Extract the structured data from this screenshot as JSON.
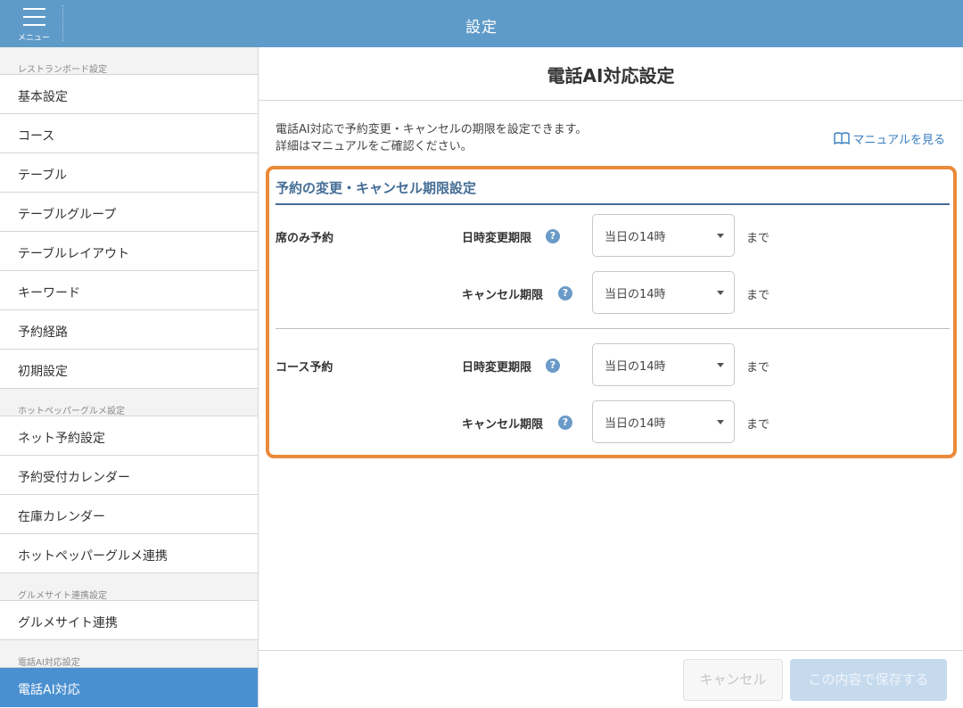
{
  "header": {
    "menu_label": "メニュー",
    "title": "設定"
  },
  "sidebar": {
    "section1": "レストランボード設定",
    "items1": [
      "基本設定",
      "コース",
      "テーブル",
      "テーブルグループ",
      "テーブルレイアウト",
      "キーワード",
      "予約経路",
      "初期設定"
    ],
    "section2": "ホットペッパーグルメ設定",
    "items2": [
      "ネット予約設定",
      "予約受付カレンダー",
      "在庫カレンダー",
      "ホットペッパーグルメ連携"
    ],
    "section3": "グルメサイト連携設定",
    "items3": [
      "グルメサイト連携"
    ],
    "section4": "電話AI対応設定",
    "items4": [
      "電話AI対応"
    ]
  },
  "main": {
    "title": "電話AI対応設定",
    "desc_line1": "電話AI対応で予約変更・キャンセルの期限を設定できます。",
    "desc_line2": "詳細はマニュアルをご確認ください。",
    "manual_link": "マニュアルを見る",
    "panel_title": "予約の変更・キャンセル期限設定",
    "seat_only": {
      "label": "席のみ予約",
      "change_label": "日時変更期限",
      "change_value": "当日の14時",
      "cancel_label": "キャンセル期限",
      "cancel_value": "当日の14時"
    },
    "course": {
      "label": "コース予約",
      "change_label": "日時変更期限",
      "change_value": "当日の14時",
      "cancel_label": "キャンセル期限",
      "cancel_value": "当日の14時"
    },
    "suffix": "まで",
    "help": "?"
  },
  "footer": {
    "cancel": "キャンセル",
    "save": "この内容で保存する"
  },
  "colors": {
    "header": "#5f9bc9",
    "active": "#4a90d0",
    "highlight": "#ea8a3a",
    "section_title": "#446d96"
  }
}
